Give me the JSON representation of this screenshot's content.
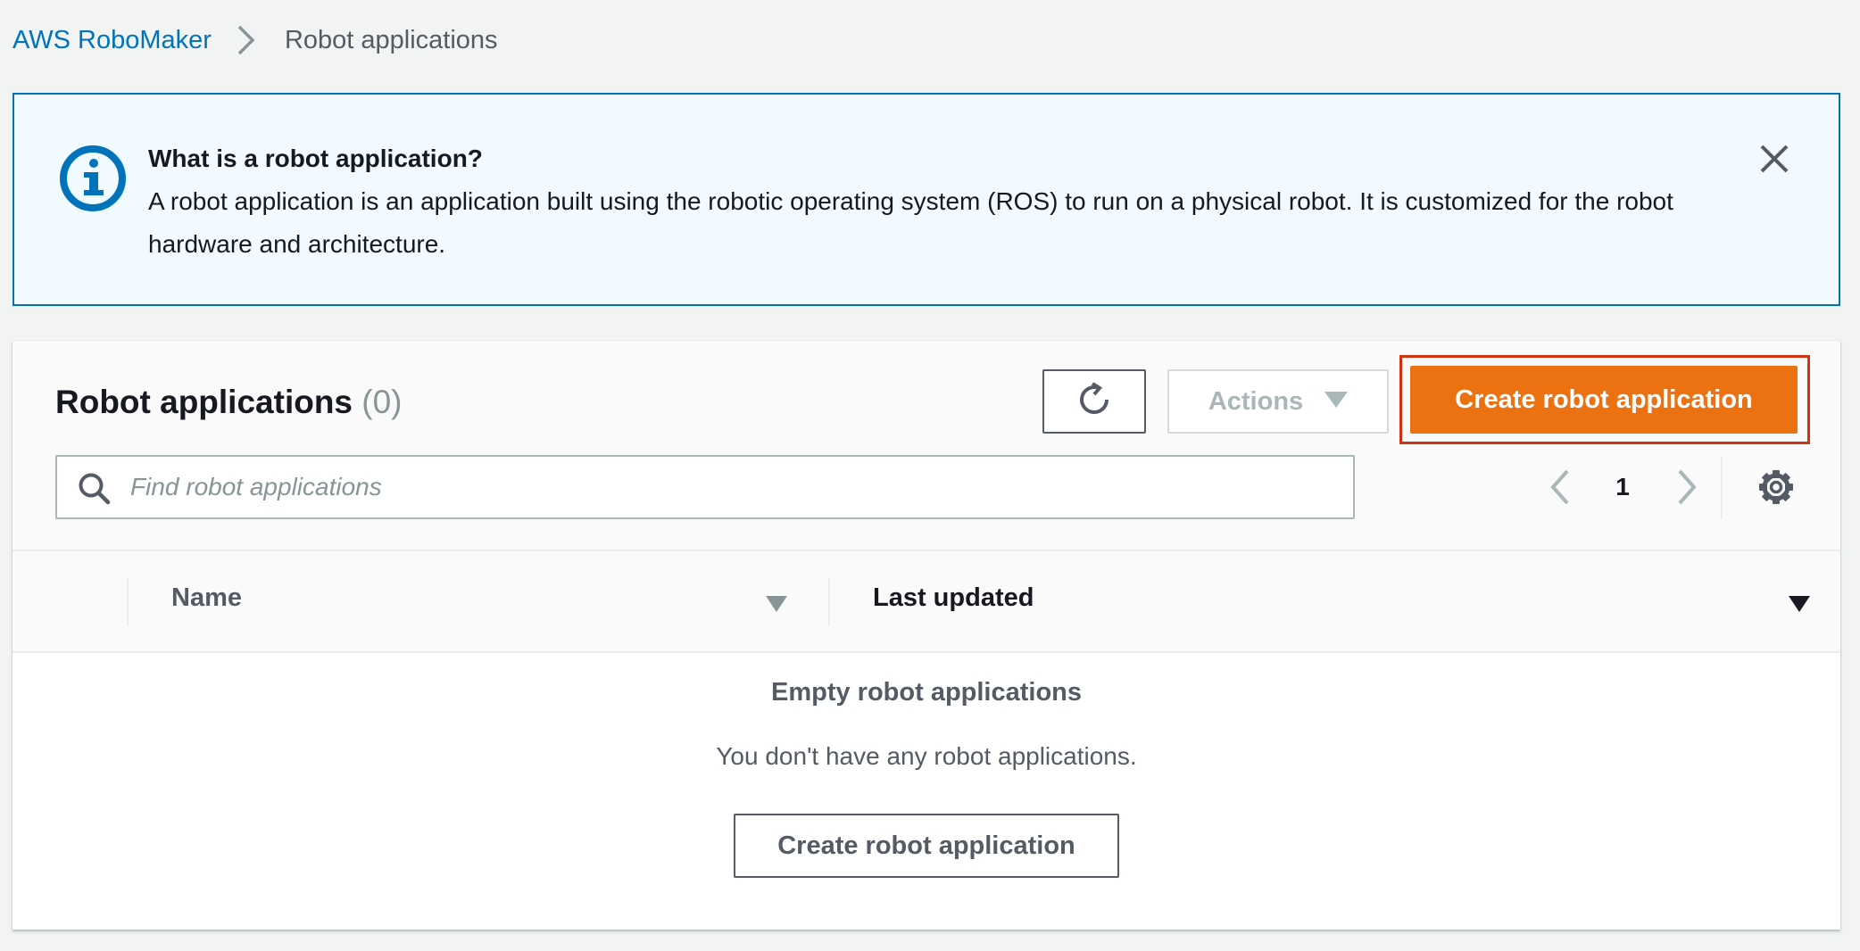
{
  "breadcrumb": {
    "root": "AWS RoboMaker",
    "current": "Robot applications"
  },
  "alert": {
    "title": "What is a robot application?",
    "body": "A robot application is an application built using the robotic operating system (ROS) to run on a physical robot. It is customized for the robot hardware and architecture.",
    "icon": "info-icon",
    "close_icon": "close-icon"
  },
  "panel": {
    "title": "Robot applications",
    "count": "(0)",
    "actions_label": "Actions",
    "create_label": "Create robot application",
    "refresh_icon": "refresh-icon"
  },
  "search": {
    "placeholder": "Find robot applications",
    "value": ""
  },
  "pagination": {
    "current_page": "1"
  },
  "table": {
    "columns": [
      "Name",
      "Last updated"
    ]
  },
  "empty_state": {
    "title": "Empty robot applications",
    "message": "You don't have any robot applications.",
    "button_label": "Create robot application"
  },
  "colors": {
    "primary": "#ec7211",
    "link": "#0073bb",
    "info_background": "#f1faff",
    "highlight": "#d13212"
  }
}
